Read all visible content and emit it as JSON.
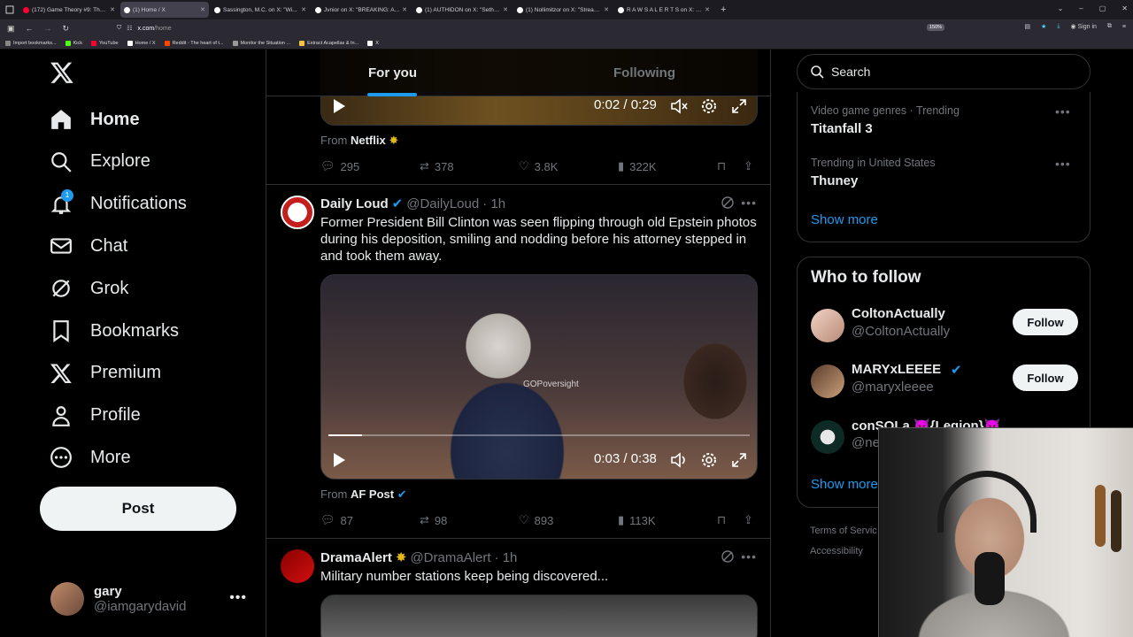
{
  "browser": {
    "tabs": [
      {
        "title": "(172) Game Theory #9: The US...",
        "color": "#ff0033"
      },
      {
        "title": "(1) Home / X",
        "color": "#ffffff",
        "active": true
      },
      {
        "title": "Sassington, M.C. on X: \"Wi...",
        "color": "#ffffff"
      },
      {
        "title": "Jvnior on X: \"BREAKING: A...",
        "color": "#ffffff"
      },
      {
        "title": "(1) AUTHIDON on X: \"Seth R...",
        "color": "#ffffff"
      },
      {
        "title": "(1) Nollimitzor on X: \"Streamer I...",
        "color": "#ffffff"
      },
      {
        "title": "R A W S A L E R T S on X: \"...",
        "color": "#ffffff"
      }
    ],
    "url_host": "x.com",
    "url_path": "/home",
    "zoom": "150%",
    "signin": "Sign in",
    "bookmarks": [
      {
        "label": "Import bookmarks...",
        "color": "#888888"
      },
      {
        "label": "Kick",
        "color": "#53fc18"
      },
      {
        "label": "YouTube",
        "color": "#ff0033"
      },
      {
        "label": "Home / X",
        "color": "#ffffff"
      },
      {
        "label": "Reddit - The heart of t...",
        "color": "#ff4500"
      },
      {
        "label": "Monitor the Situation ...",
        "color": "#999999"
      },
      {
        "label": "Extract Acapellas & In...",
        "color": "#f5c542"
      },
      {
        "label": "X",
        "color": "#ffffff"
      }
    ]
  },
  "nav": {
    "items": [
      {
        "label": "Home",
        "icon": "home-icon"
      },
      {
        "label": "Explore",
        "icon": "search-icon"
      },
      {
        "label": "Notifications",
        "icon": "bell-icon",
        "badge": "1"
      },
      {
        "label": "Chat",
        "icon": "mail-icon"
      },
      {
        "label": "Grok",
        "icon": "grok-icon"
      },
      {
        "label": "Bookmarks",
        "icon": "bookmark-icon"
      },
      {
        "label": "Premium",
        "icon": "x-logo-icon"
      },
      {
        "label": "Profile",
        "icon": "person-icon"
      },
      {
        "label": "More",
        "icon": "more-circle-icon"
      }
    ],
    "post_label": "Post",
    "account": {
      "name": "gary",
      "handle": "@iamgarydavid"
    }
  },
  "feed": {
    "tabs": [
      "For you",
      "Following"
    ],
    "post1": {
      "video_time": "0:02 / 0:29",
      "from_prefix": "From",
      "from_name": "Netflix",
      "replies": "295",
      "reposts": "378",
      "likes": "3.8K",
      "views": "322K"
    },
    "post2": {
      "name": "Daily Loud",
      "handle": "@DailyLoud",
      "time": "· 1h",
      "text": "Former President Bill Clinton was seen flipping through old Epstein photos during his deposition, smiling and nodding before his attorney stepped in and took them away.",
      "watermark": "GOPoversight",
      "video_time": "0:03 / 0:38",
      "progress": 0.08,
      "from_prefix": "From",
      "from_name": "AF Post",
      "replies": "87",
      "reposts": "98",
      "likes": "893",
      "views": "113K"
    },
    "post3": {
      "name": "DramaAlert",
      "handle": "@DramaAlert",
      "time": "· 1h",
      "text": "Military number stations keep being discovered..."
    }
  },
  "sidebar": {
    "search_placeholder": "Search",
    "trends": [
      {
        "context": "Video game genres · Trending",
        "title": "Titanfall 3"
      },
      {
        "context": "Trending in United States",
        "title": "Thuney"
      }
    ],
    "show_more": "Show more",
    "who_to_follow": "Who to follow",
    "follow": [
      {
        "name": "ColtonActually",
        "handle": "@ColtonActually",
        "button": "Follow"
      },
      {
        "name": "MARYxLEEEE",
        "handle": "@maryxleeee",
        "button": "Follow"
      },
      {
        "name": "conSOLa 😈{Legion}😈",
        "handle": "@ne",
        "button": ""
      }
    ],
    "show_more_2": "Show more",
    "footer": [
      "Terms of Servic",
      "Accessibility"
    ]
  },
  "colors": {
    "accent": "#1d9bf0",
    "verified_gold": "#e2b719"
  }
}
